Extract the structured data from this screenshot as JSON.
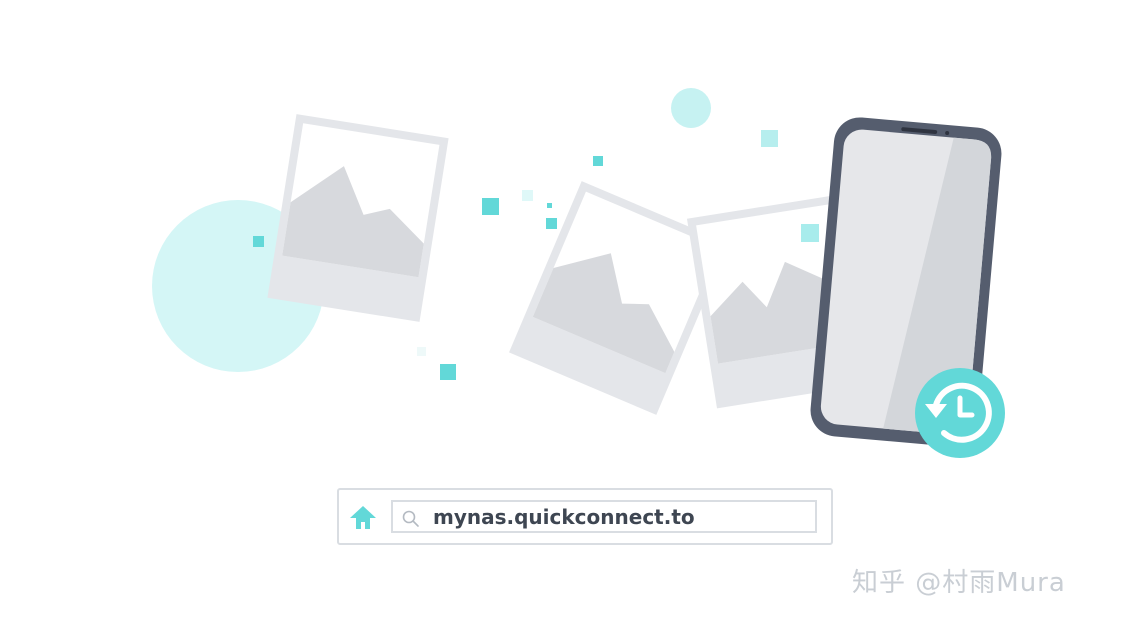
{
  "address_bar": {
    "url": "mynas.quickconnect.to",
    "home_icon": "home-icon",
    "search_icon": "search-icon"
  },
  "illustration": {
    "photo_icon": "image-placeholder-icon",
    "phone_icon": "smartphone-icon",
    "restore_icon": "restore-history-icon"
  },
  "watermark": {
    "text": "知乎 @村雨Mura"
  },
  "colors": {
    "accent": "#62d8d8",
    "accent_light": "#d4f6f6",
    "photo_frame": "#e4e6ea",
    "photo_image": "#d7d9dd",
    "phone_body": "#555d6e",
    "phone_screen": "#e6e7ea",
    "text": "#3e4652",
    "border": "#d9dde2"
  }
}
